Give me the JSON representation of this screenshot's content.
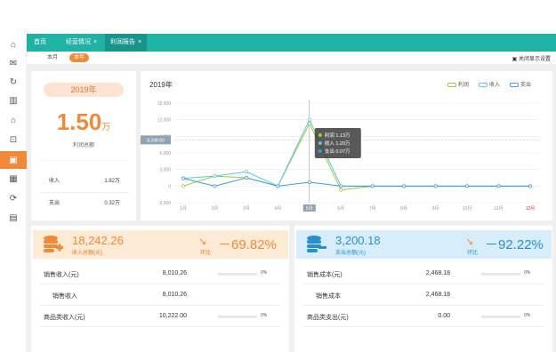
{
  "tabs": [
    {
      "label": "首页",
      "closable": false
    },
    {
      "label": "经营情况",
      "closable": true
    },
    {
      "label": "利润报告",
      "closable": true
    }
  ],
  "close_glyph": "×",
  "subtabs": [
    "本月",
    "本年"
  ],
  "fullscreen_label": "关闭显示设置",
  "sidebar_icons": [
    "home-icon",
    "mail-icon",
    "refresh-icon",
    "building-icon",
    "house-icon",
    "lock-icon",
    "wallet-icon",
    "table-icon",
    "sync-icon",
    "report-icon"
  ],
  "summary": {
    "year_label": "2019年",
    "big_value": "1.50",
    "big_unit": "万",
    "big_label": "利润总额",
    "income_label": "收入",
    "income_value": "1.82万",
    "expense_label": "支出",
    "expense_value": "0.32万"
  },
  "chart_data": {
    "type": "line",
    "title": "2019年",
    "categories": [
      "1月",
      "2月",
      "3月",
      "4月",
      "5月",
      "6月",
      "7月",
      "8月",
      "9月",
      "10月",
      "11月",
      "12月"
    ],
    "yticks": [
      "15,000",
      "12,000",
      "9,000",
      "6,000",
      "3,000",
      "0",
      "-3,000"
    ],
    "ylim": [
      -3000,
      15000
    ],
    "series": [
      {
        "name": "利润",
        "color": "#9ccc35",
        "values": [
          0,
          1800,
          1500,
          0,
          11300,
          -700,
          0,
          0,
          0,
          0,
          0,
          0
        ]
      },
      {
        "name": "收入",
        "color": "#55c7e8",
        "values": [
          1400,
          1800,
          2600,
          0,
          12000,
          0,
          0,
          0,
          0,
          0,
          0,
          0
        ]
      },
      {
        "name": "支出",
        "color": "#3c9bd9",
        "values": [
          1400,
          0,
          1500,
          0,
          700,
          0,
          0,
          0,
          0,
          0,
          0,
          0
        ]
      }
    ],
    "crosshair_value": "8,348.89",
    "crosshair_category": "5月",
    "highlight_category": "12月",
    "tooltip": [
      {
        "label": "利润 1.13万",
        "color": "#9ccc35"
      },
      {
        "label": "收入 1.20万",
        "color": "#55c7e8"
      },
      {
        "label": "支出 0.07万",
        "color": "#3c9bd9"
      }
    ]
  },
  "income_kpi": {
    "value": "18,242.26",
    "label": "收入总额(元)",
    "hb_label": "环比",
    "change": "－69.82%",
    "bg": "#fdebd6",
    "color": "#f08a3a",
    "icon": "coin-stack-plus-icon"
  },
  "expense_kpi": {
    "value": "3,200.18",
    "label": "支出总额(元)",
    "hb_label": "环比",
    "change": "－92.22%",
    "bg": "#d7edf9",
    "color": "#2a8fd0",
    "icon": "coin-stack-minus-icon"
  },
  "income_rows": [
    {
      "label": "销售收入(元)",
      "value": "8,010.26",
      "pct": "0%"
    },
    {
      "label": "销售收入",
      "value": "8,010.26",
      "pct": ""
    },
    {
      "label": "商品类收入(元)",
      "value": "10,222.00",
      "pct": "0%"
    }
  ],
  "expense_rows": [
    {
      "label": "销售成本(元)",
      "value": "2,468.18",
      "pct": "0%"
    },
    {
      "label": "销售成本",
      "value": "2,468.18",
      "pct": ""
    },
    {
      "label": "商品类支出(元)",
      "value": "0.00",
      "pct": "0%"
    }
  ]
}
